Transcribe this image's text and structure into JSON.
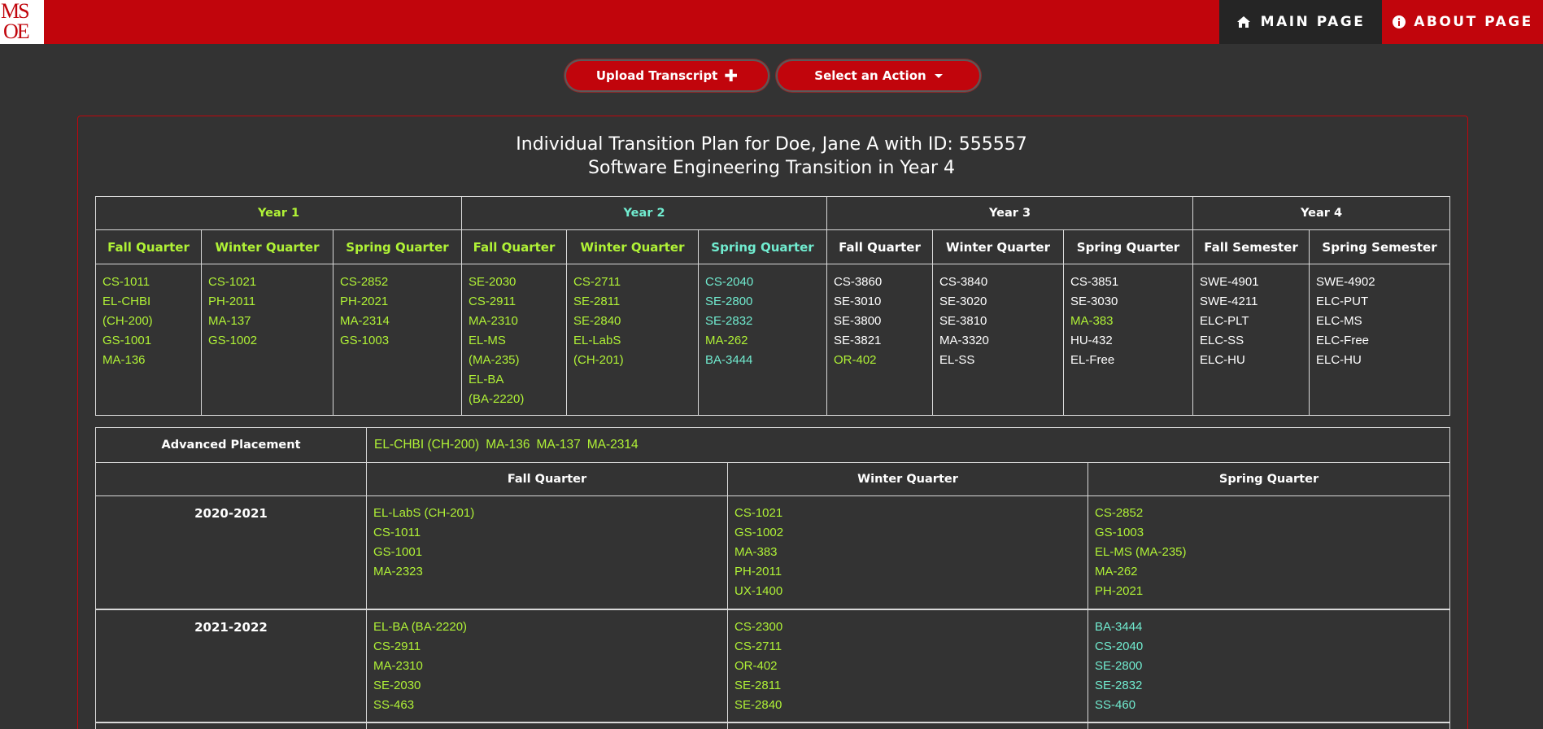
{
  "nav": {
    "logo_top": "MS",
    "logo_bottom": "OE",
    "main_page": "MAIN PAGE",
    "about_page": "ABOUT PAGE"
  },
  "actions": {
    "upload": "Upload Transcript",
    "select": "Select an Action"
  },
  "plan": {
    "title_line1": "Individual Transition Plan for Doe, Jane A with ID: 555557",
    "title_line2": "Software Engineering Transition in Year 4",
    "years": [
      {
        "label": "Year 1",
        "color": "#b0f236"
      },
      {
        "label": "Year 2",
        "color": "#71ecd0"
      },
      {
        "label": "Year 3",
        "color": "#ffffff"
      },
      {
        "label": "Year 4",
        "color": "#ffffff"
      }
    ],
    "terms": [
      {
        "label": "Fall Quarter",
        "color": "#b0f236",
        "courses": [
          {
            "c": "CS-1011",
            "k": "lime"
          },
          {
            "c": "EL-CHBI",
            "k": "lime"
          },
          {
            "c": "(CH-200)",
            "k": "lime"
          },
          {
            "c": "GS-1001",
            "k": "lime"
          },
          {
            "c": "MA-136",
            "k": "lime"
          }
        ]
      },
      {
        "label": "Winter Quarter",
        "color": "#b0f236",
        "courses": [
          {
            "c": "CS-1021",
            "k": "lime"
          },
          {
            "c": "PH-2011",
            "k": "lime"
          },
          {
            "c": "MA-137",
            "k": "lime"
          },
          {
            "c": "GS-1002",
            "k": "lime"
          }
        ]
      },
      {
        "label": "Spring Quarter",
        "color": "#b0f236",
        "courses": [
          {
            "c": "CS-2852",
            "k": "lime"
          },
          {
            "c": "PH-2021",
            "k": "lime"
          },
          {
            "c": "MA-2314",
            "k": "lime"
          },
          {
            "c": "GS-1003",
            "k": "lime"
          }
        ]
      },
      {
        "label": "Fall Quarter",
        "color": "#b0f236",
        "courses": [
          {
            "c": "SE-2030",
            "k": "lime"
          },
          {
            "c": "CS-2911",
            "k": "lime"
          },
          {
            "c": "MA-2310",
            "k": "lime"
          },
          {
            "c": "EL-MS",
            "k": "lime"
          },
          {
            "c": "(MA-235)",
            "k": "lime"
          },
          {
            "c": "EL-BA",
            "k": "lime"
          },
          {
            "c": "(BA-2220)",
            "k": "lime"
          }
        ]
      },
      {
        "label": "Winter Quarter",
        "color": "#b0f236",
        "courses": [
          {
            "c": "CS-2711",
            "k": "lime"
          },
          {
            "c": "SE-2811",
            "k": "lime"
          },
          {
            "c": "SE-2840",
            "k": "lime"
          },
          {
            "c": "EL-LabS",
            "k": "lime"
          },
          {
            "c": "(CH-201)",
            "k": "lime"
          }
        ]
      },
      {
        "label": "Spring Quarter",
        "color": "#71ecd0",
        "courses": [
          {
            "c": "CS-2040",
            "k": "cyan"
          },
          {
            "c": "SE-2800",
            "k": "cyan"
          },
          {
            "c": "SE-2832",
            "k": "cyan"
          },
          {
            "c": "MA-262",
            "k": "lime"
          },
          {
            "c": "BA-3444",
            "k": "cyan"
          }
        ]
      },
      {
        "label": "Fall Quarter",
        "color": "#ffffff",
        "courses": [
          {
            "c": "CS-3860",
            "k": "white"
          },
          {
            "c": "SE-3010",
            "k": "white"
          },
          {
            "c": "SE-3800",
            "k": "white"
          },
          {
            "c": "SE-3821",
            "k": "white"
          },
          {
            "c": "OR-402",
            "k": "lime"
          }
        ]
      },
      {
        "label": "Winter Quarter",
        "color": "#ffffff",
        "courses": [
          {
            "c": "CS-3840",
            "k": "white"
          },
          {
            "c": "SE-3020",
            "k": "white"
          },
          {
            "c": "SE-3810",
            "k": "white"
          },
          {
            "c": "MA-3320",
            "k": "white"
          },
          {
            "c": "EL-SS",
            "k": "white"
          }
        ]
      },
      {
        "label": "Spring Quarter",
        "color": "#ffffff",
        "courses": [
          {
            "c": "CS-3851",
            "k": "white"
          },
          {
            "c": "SE-3030",
            "k": "white"
          },
          {
            "c": "MA-383",
            "k": "lime"
          },
          {
            "c": "HU-432",
            "k": "white"
          },
          {
            "c": "EL-Free",
            "k": "white"
          }
        ]
      },
      {
        "label": "Fall Semester",
        "color": "#ffffff",
        "courses": [
          {
            "c": "SWE-4901",
            "k": "white"
          },
          {
            "c": "SWE-4211",
            "k": "white"
          },
          {
            "c": "ELC-PLT",
            "k": "white"
          },
          {
            "c": "ELC-SS",
            "k": "white"
          },
          {
            "c": "ELC-HU",
            "k": "white"
          }
        ]
      },
      {
        "label": "Spring Semester",
        "color": "#ffffff",
        "courses": [
          {
            "c": "SWE-4902",
            "k": "white"
          },
          {
            "c": "ELC-PUT",
            "k": "white"
          },
          {
            "c": "ELC-MS",
            "k": "white"
          },
          {
            "c": "ELC-Free",
            "k": "white"
          },
          {
            "c": "ELC-HU",
            "k": "white"
          }
        ]
      }
    ]
  },
  "history": {
    "ap_label": "Advanced Placement",
    "ap_items": [
      "EL-CHBI (CH-200)",
      "MA-136",
      "MA-137",
      "MA-2314"
    ],
    "headers": [
      "Fall Quarter",
      "Winter Quarter",
      "Spring Quarter"
    ],
    "years": [
      {
        "label": "2020-2021",
        "fall": [
          {
            "c": "EL-LabS (CH-201)",
            "k": "lime"
          },
          {
            "c": "CS-1011",
            "k": "lime"
          },
          {
            "c": "GS-1001",
            "k": "lime"
          },
          {
            "c": "MA-2323",
            "k": "lime"
          }
        ],
        "winter": [
          {
            "c": "CS-1021",
            "k": "lime"
          },
          {
            "c": "GS-1002",
            "k": "lime"
          },
          {
            "c": "MA-383",
            "k": "lime"
          },
          {
            "c": "PH-2011",
            "k": "lime"
          },
          {
            "c": "UX-1400",
            "k": "lime"
          }
        ],
        "spring": [
          {
            "c": "CS-2852",
            "k": "lime"
          },
          {
            "c": "GS-1003",
            "k": "lime"
          },
          {
            "c": "EL-MS (MA-235)",
            "k": "lime"
          },
          {
            "c": "MA-262",
            "k": "lime"
          },
          {
            "c": "PH-2021",
            "k": "lime"
          }
        ]
      },
      {
        "label": "2021-2022",
        "fall": [
          {
            "c": "EL-BA (BA-2220)",
            "k": "lime"
          },
          {
            "c": "CS-2911",
            "k": "lime"
          },
          {
            "c": "MA-2310",
            "k": "lime"
          },
          {
            "c": "SE-2030",
            "k": "lime"
          },
          {
            "c": "SS-463",
            "k": "lime"
          }
        ],
        "winter": [
          {
            "c": "CS-2300",
            "k": "lime"
          },
          {
            "c": "CS-2711",
            "k": "lime"
          },
          {
            "c": "OR-402",
            "k": "lime"
          },
          {
            "c": "SE-2811",
            "k": "lime"
          },
          {
            "c": "SE-2840",
            "k": "lime"
          }
        ],
        "spring": [
          {
            "c": "BA-3444",
            "k": "cyan"
          },
          {
            "c": "CS-2040",
            "k": "cyan"
          },
          {
            "c": "SE-2800",
            "k": "cyan"
          },
          {
            "c": "SE-2832",
            "k": "cyan"
          },
          {
            "c": "SS-460",
            "k": "cyan"
          }
        ]
      }
    ]
  }
}
